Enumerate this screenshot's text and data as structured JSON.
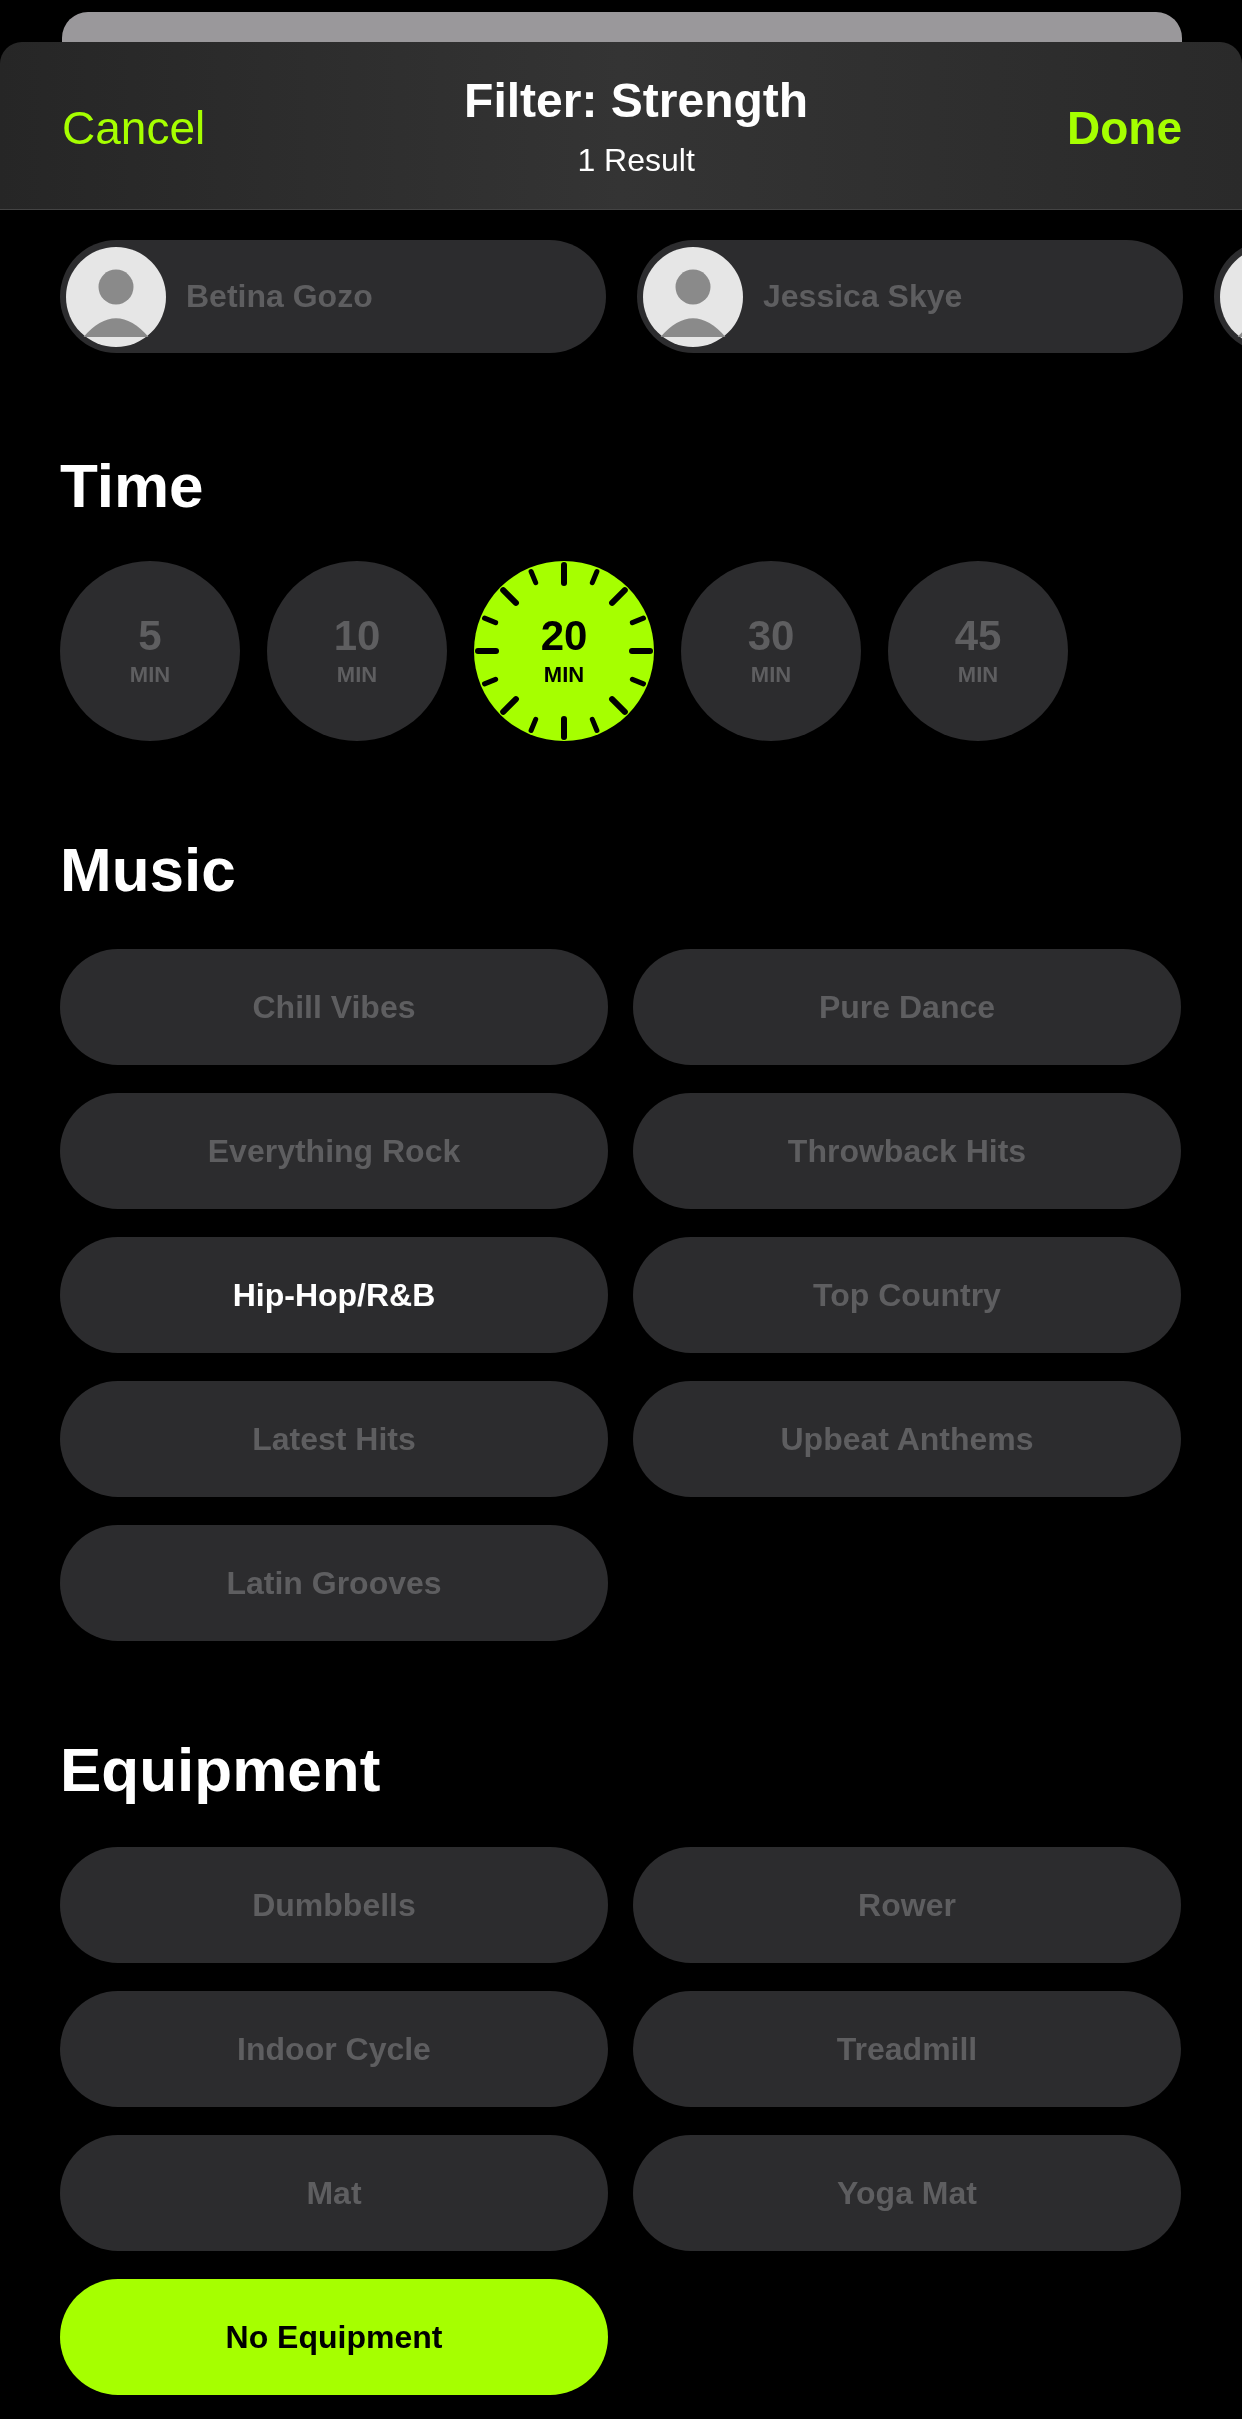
{
  "header": {
    "cancel": "Cancel",
    "title": "Filter: Strength",
    "subtitle": "1 Result",
    "done": "Done"
  },
  "trainers": [
    {
      "name": "Betina Gozo",
      "selected": false
    },
    {
      "name": "Jessica Skye",
      "selected": false
    },
    {
      "selected": false
    }
  ],
  "time": {
    "heading": "Time",
    "options": [
      {
        "value": "5",
        "unit": "MIN",
        "selected": false
      },
      {
        "value": "10",
        "unit": "MIN",
        "selected": false
      },
      {
        "value": "20",
        "unit": "MIN",
        "selected": true
      },
      {
        "value": "30",
        "unit": "MIN",
        "selected": false
      },
      {
        "value": "45",
        "unit": "MIN",
        "selected": false
      }
    ]
  },
  "music": {
    "heading": "Music",
    "options": [
      {
        "label": "Chill Vibes",
        "selected": false
      },
      {
        "label": "Pure Dance",
        "selected": false
      },
      {
        "label": "Everything Rock",
        "selected": false
      },
      {
        "label": "Throwback Hits",
        "selected": false
      },
      {
        "label": "Hip-Hop/R&B",
        "selected": true
      },
      {
        "label": "Top Country",
        "selected": false
      },
      {
        "label": "Latest Hits",
        "selected": false
      },
      {
        "label": "Upbeat Anthems",
        "selected": false
      },
      {
        "label": "Latin Grooves",
        "selected": false
      }
    ]
  },
  "equipment": {
    "heading": "Equipment",
    "options": [
      {
        "label": "Dumbbells",
        "selected": false
      },
      {
        "label": "Rower",
        "selected": false
      },
      {
        "label": "Indoor Cycle",
        "selected": false
      },
      {
        "label": "Treadmill",
        "selected": false
      },
      {
        "label": "Mat",
        "selected": false
      },
      {
        "label": "Yoga Mat",
        "selected": false
      },
      {
        "label": "No Equipment",
        "selected": true
      }
    ]
  }
}
